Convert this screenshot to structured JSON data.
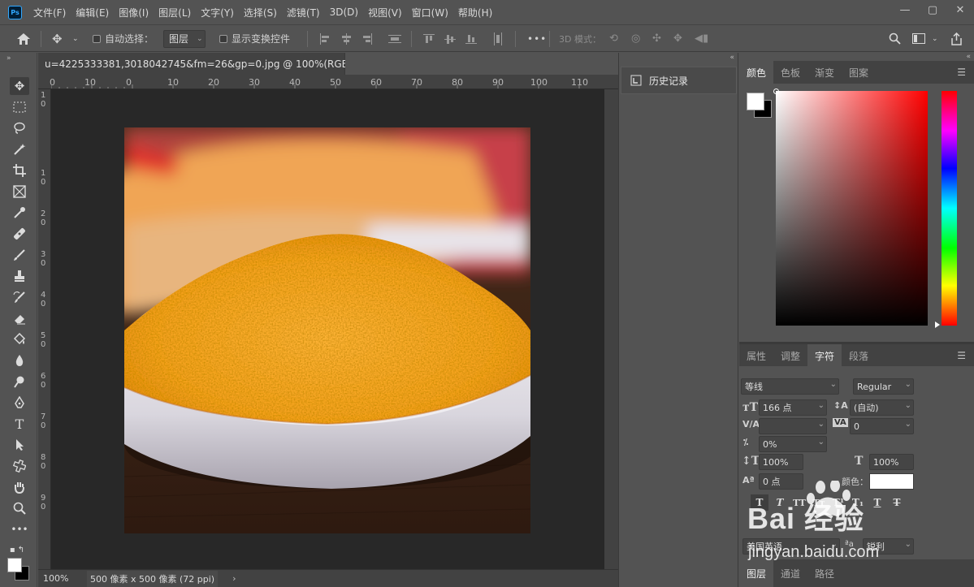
{
  "menubar": {
    "logo": "Ps",
    "items": [
      "文件(F)",
      "编辑(E)",
      "图像(I)",
      "图层(L)",
      "文字(Y)",
      "选择(S)",
      "滤镜(T)",
      "3D(D)",
      "视图(V)",
      "窗口(W)",
      "帮助(H)"
    ],
    "window_controls": [
      "minimize-icon",
      "restore-icon",
      "close-icon"
    ]
  },
  "options": {
    "auto_select_label": "自动选择：",
    "auto_select_value": "图层",
    "show_transform_label": "显示变换控件",
    "more": "•••",
    "mode_3d_label": "3D 模式："
  },
  "document": {
    "tab_title": "u=4225333381,3018042745&fm=26&gp=0.jpg @ 100%(RGB/8#)",
    "tab_close": "×",
    "ruler_top_labels": [
      "0",
      "10",
      "0",
      "10",
      "20",
      "30",
      "40",
      "50",
      "60",
      "70",
      "80",
      "90",
      "100",
      "110"
    ],
    "ruler_left_labels": [
      "1\n0",
      "1\n0",
      "2\n0",
      "3\n0",
      "4\n0",
      "5\n0",
      "6\n0",
      "7\n0",
      "8\n0",
      "9\n0"
    ],
    "zoom": "100%",
    "doc_info": "500 像素 x 500 像素 (72 ppi)",
    "status_arrow": "›"
  },
  "history": {
    "label": "历史记录"
  },
  "color_panel": {
    "tabs": [
      "颜色",
      "色板",
      "渐变",
      "图案"
    ],
    "active_tab": "颜色",
    "foreground": "#ffffff",
    "background": "#000000",
    "picker_hue": "#ff0000"
  },
  "character_panel": {
    "tabs": [
      "属性",
      "调整",
      "字符",
      "段落"
    ],
    "active_tab": "字符",
    "font_family": "等线",
    "font_style": "Regular",
    "font_size": "166 点",
    "leading": "(自动)",
    "kerning": "",
    "tracking": "0",
    "tsume": "0%",
    "vertical_scale": "100%",
    "horizontal_scale": "100%",
    "baseline_shift": "0 点",
    "color_label": "颜色：",
    "text_color": "#ffffff",
    "style_buttons": [
      "T",
      "T",
      "TT",
      "Tт",
      "T¹",
      "T₁",
      "T",
      "T"
    ],
    "language": "美国英语",
    "antialias": "锐利",
    "aa_label": "ªa"
  },
  "layers": {
    "tabs": [
      "图层",
      "通道",
      "路径"
    ]
  },
  "watermark": {
    "text": "Bai 经验",
    "url": "jingyan.baidu.com"
  }
}
